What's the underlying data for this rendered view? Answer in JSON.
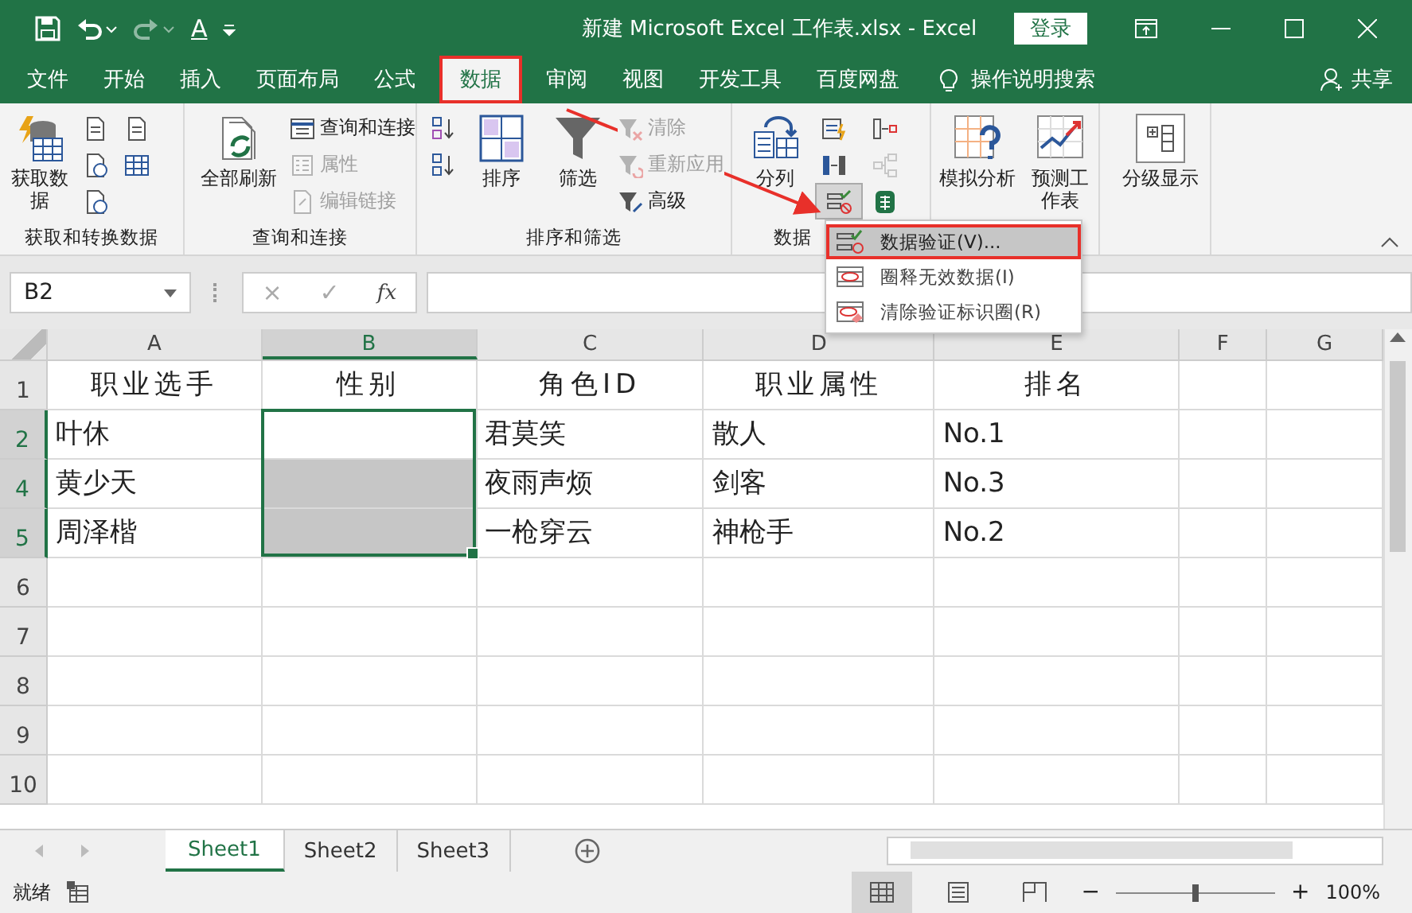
{
  "title_bar": {
    "font_color_glyph": "A",
    "title": "新建 Microsoft Excel 工作表.xlsx  -  Excel",
    "login_button": "登录"
  },
  "menu_tabs": [
    {
      "label": "文件",
      "selected": false
    },
    {
      "label": "开始",
      "selected": false
    },
    {
      "label": "插入",
      "selected": false
    },
    {
      "label": "页面布局",
      "selected": false
    },
    {
      "label": "公式",
      "selected": false
    },
    {
      "label": "数据",
      "selected": true
    },
    {
      "label": "审阅",
      "selected": false
    },
    {
      "label": "视图",
      "selected": false
    },
    {
      "label": "开发工具",
      "selected": false
    },
    {
      "label": "百度网盘",
      "selected": false
    }
  ],
  "tell_me": "操作说明搜索",
  "share": "共享",
  "ribbon_groups": [
    {
      "label": "获取和转换数据",
      "items": [
        {
          "kind": "large",
          "label": "获取数据",
          "disabled": false
        },
        {
          "kind": "icon",
          "disabled": false
        },
        {
          "kind": "icon",
          "disabled": false
        },
        {
          "kind": "icon",
          "disabled": false
        },
        {
          "kind": "icon",
          "disabled": false
        },
        {
          "kind": "icon",
          "disabled": false
        }
      ]
    },
    {
      "label": "查询和连接",
      "items": [
        {
          "kind": "large",
          "label": "全部刷新",
          "disabled": false
        },
        {
          "kind": "small",
          "label": "查询和连接",
          "disabled": false
        },
        {
          "kind": "small",
          "label": "属性",
          "disabled": true
        },
        {
          "kind": "small",
          "label": "编辑链接",
          "disabled": true
        }
      ]
    },
    {
      "label": "排序和筛选",
      "items": [
        {
          "kind": "icon",
          "disabled": false
        },
        {
          "kind": "icon",
          "disabled": false
        },
        {
          "kind": "large",
          "label": "排序",
          "disabled": false
        },
        {
          "kind": "large",
          "label": "筛选",
          "disabled": false
        },
        {
          "kind": "small",
          "label": "清除",
          "disabled": true
        },
        {
          "kind": "small",
          "label": "重新应用",
          "disabled": true
        },
        {
          "kind": "small",
          "label": "高级",
          "disabled": false
        }
      ]
    },
    {
      "label": "数据",
      "items": [
        {
          "kind": "large",
          "label": "分列",
          "disabled": false
        },
        {
          "kind": "icon",
          "disabled": false
        },
        {
          "kind": "icon",
          "disabled": false
        },
        {
          "kind": "icon",
          "disabled": false
        },
        {
          "kind": "icon",
          "disabled": false
        },
        {
          "kind": "icon",
          "disabled": true
        },
        {
          "kind": "icon",
          "disabled": false
        }
      ]
    },
    {
      "items": [
        {
          "kind": "large",
          "label": "模拟分析",
          "disabled": false
        },
        {
          "kind": "large",
          "label": "预测工作表",
          "disabled": false
        }
      ]
    },
    {
      "items": [
        {
          "kind": "large",
          "label": "分级显示",
          "disabled": false
        }
      ]
    }
  ],
  "dropdown_menu": [
    {
      "label": "数据验证(V)...",
      "selected": true
    },
    {
      "label": "圈释无效数据(I)",
      "selected": false
    },
    {
      "label": "清除验证标识圈(R)",
      "selected": false
    }
  ],
  "formula_bar": {
    "name_box": "B2",
    "cancel": "×",
    "enter": "✓",
    "function": "fx"
  },
  "columns": [
    {
      "label": "A",
      "selected": false
    },
    {
      "label": "B",
      "selected": true
    },
    {
      "label": "C",
      "selected": false
    },
    {
      "label": "D",
      "selected": false
    },
    {
      "label": "E",
      "selected": false
    },
    {
      "label": "F",
      "selected": false
    },
    {
      "label": "G",
      "selected": false
    }
  ],
  "rows": [
    {
      "number": "1",
      "selected": false,
      "cells": [
        {
          "text": "职业选手"
        },
        {
          "text": "性别"
        },
        {
          "text": "角色ID"
        },
        {
          "text": "职业属性"
        },
        {
          "text": "排名"
        }
      ]
    },
    {
      "number": "2",
      "selected": true,
      "cells": [
        {
          "text": "叶休"
        },
        {
          "shaded": false
        },
        {
          "text": "君莫笑"
        },
        {
          "text": "散人"
        },
        {
          "text": "No.1"
        }
      ]
    },
    {
      "number": "4",
      "selected": true,
      "cells": [
        {
          "text": "黄少天"
        },
        {
          "shaded": true
        },
        {
          "text": "夜雨声烦"
        },
        {
          "text": "剑客"
        },
        {
          "text": "No.3"
        }
      ]
    },
    {
      "number": "5",
      "selected": true,
      "cells": [
        {
          "text": "周泽楷"
        },
        {
          "shaded": true
        },
        {
          "text": "一枪穿云"
        },
        {
          "text": "神枪手"
        },
        {
          "text": "No.2"
        }
      ]
    },
    {
      "number": "6",
      "selected": false,
      "cells": []
    },
    {
      "number": "7",
      "selected": false,
      "cells": []
    },
    {
      "number": "8",
      "selected": false,
      "cells": []
    },
    {
      "number": "9",
      "selected": false,
      "cells": []
    },
    {
      "number": "10",
      "selected": false,
      "cells": []
    }
  ],
  "sheet_tabs": [
    {
      "label": "Sheet1",
      "selected": true
    },
    {
      "label": "Sheet2",
      "selected": false
    },
    {
      "label": "Sheet3",
      "selected": false
    }
  ],
  "status_bar": {
    "status": "就绪",
    "view_buttons": [
      {
        "selected": true
      },
      {
        "selected": false
      },
      {
        "selected": false
      }
    ],
    "zoom_out": "−",
    "zoom_slider": {
      "level": 0.5
    },
    "zoom_in": "+",
    "zoom": "100%"
  }
}
